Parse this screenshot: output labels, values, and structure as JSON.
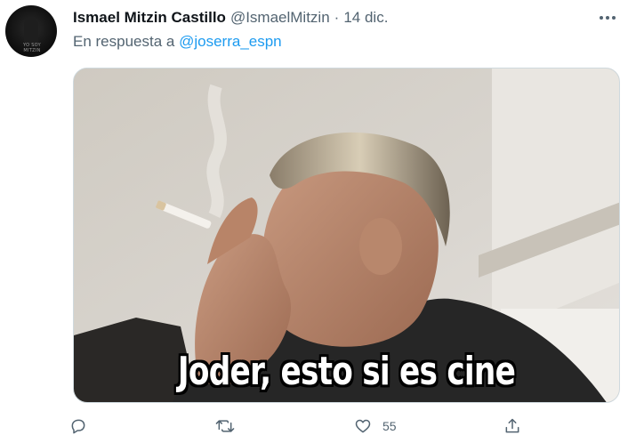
{
  "tweet": {
    "author_name": "Ismael Mitzin Castillo",
    "author_handle": "@IsmaelMitzin",
    "separator": "·",
    "date": "14 dic.",
    "reply_prefix": "En respuesta a",
    "reply_mention": "@joserra_espn",
    "media_caption": "Joder, esto si es cine",
    "avatar_text": "YO SOY MITZIN"
  },
  "actions": {
    "reply_count": "",
    "retweet_count": "",
    "like_count": "55",
    "share_count": ""
  },
  "icons": {
    "more": "more-horizontal-icon",
    "reply": "reply-bubble-icon",
    "retweet": "retweet-icon",
    "like": "heart-icon",
    "share": "share-upload-icon"
  },
  "colors": {
    "text_primary": "#0f1419",
    "text_secondary": "#536471",
    "link": "#1d9bf0",
    "border": "#cfd9de"
  }
}
